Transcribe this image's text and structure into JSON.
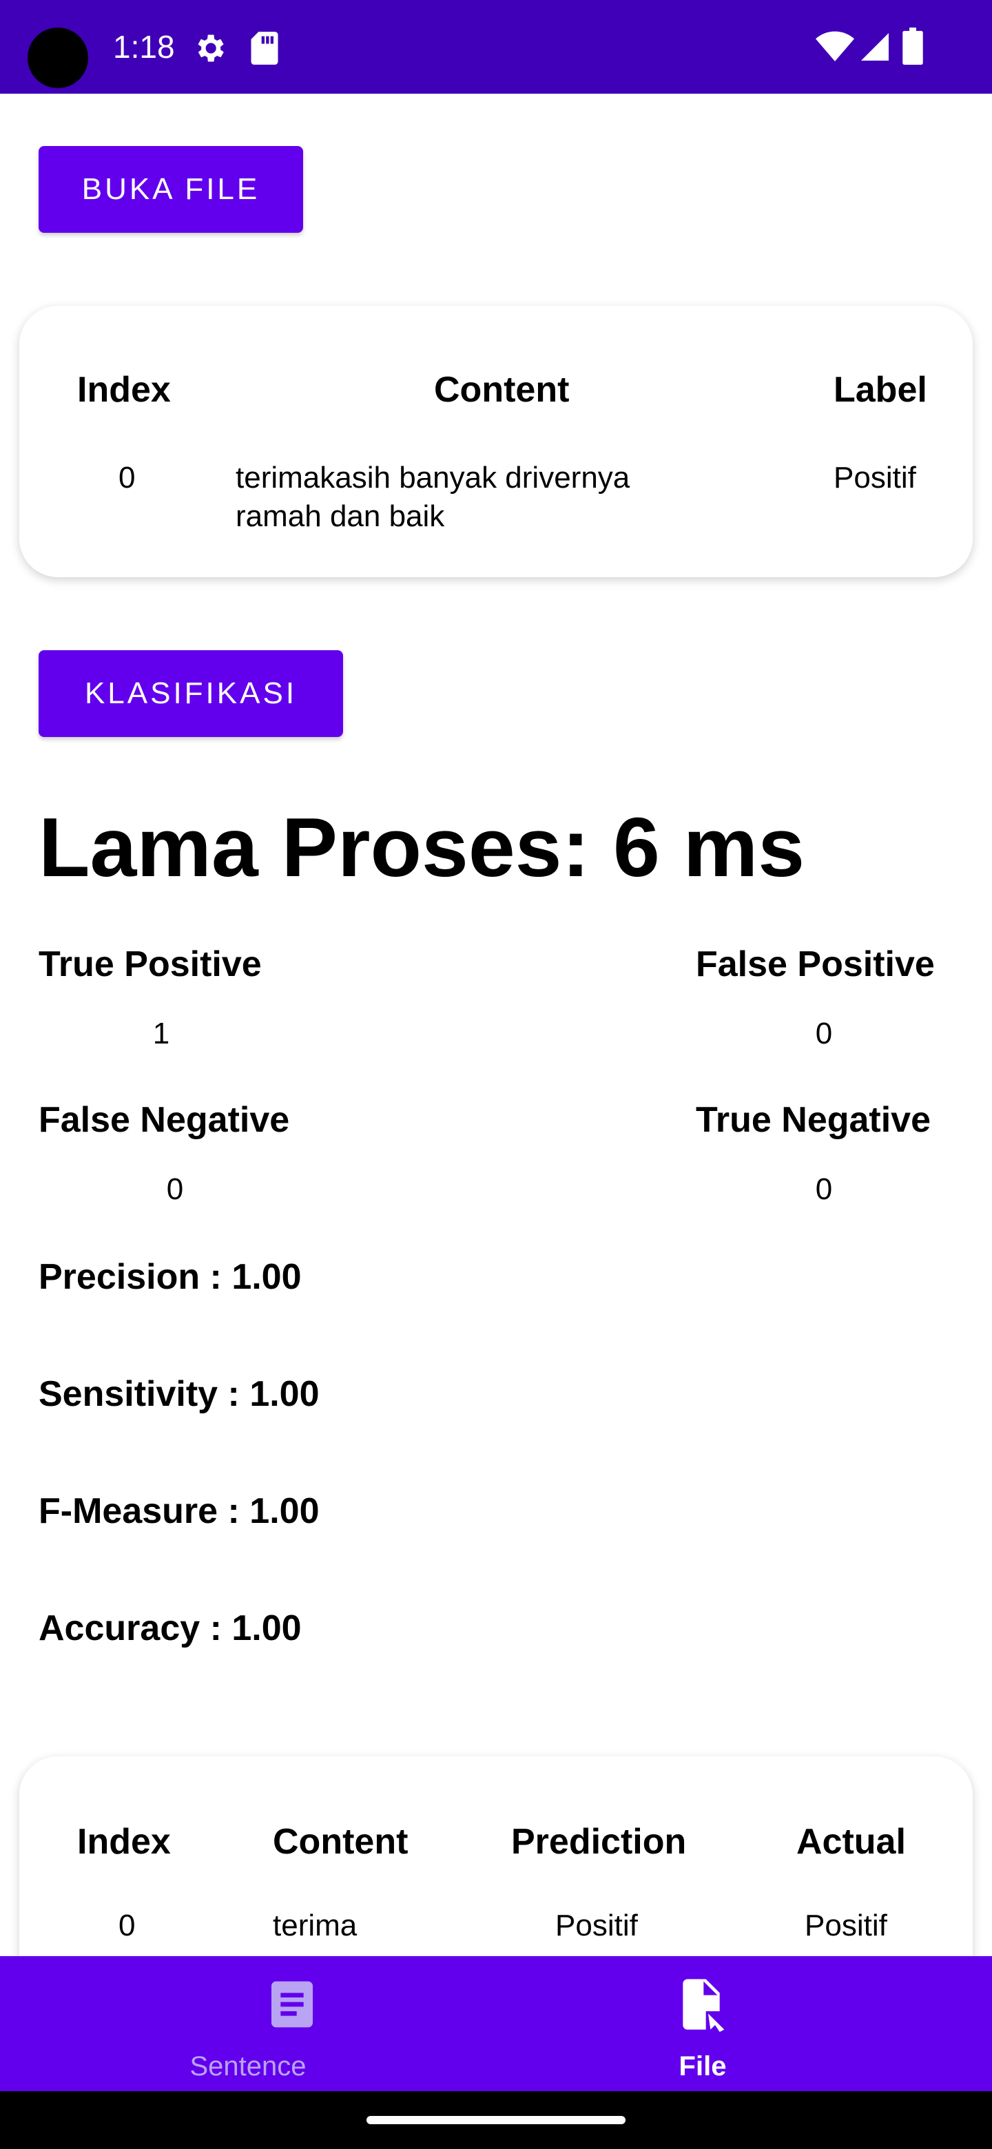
{
  "status_bar": {
    "time": "1:18",
    "icons": [
      "settings-gear-icon",
      "sd-card-icon",
      "wifi-icon",
      "cellular-signal-icon",
      "battery-icon"
    ]
  },
  "buka_file_button": "BUKA FILE",
  "input_table": {
    "headers": [
      "Index",
      "Content",
      "Label"
    ],
    "rows": [
      {
        "index": "0",
        "content_line1": "terimakasih banyak drivernya",
        "content_line2": "ramah dan baik",
        "label": "Positif"
      }
    ]
  },
  "klasifikasi_button": "KLASIFIKASI",
  "processing_time": "Lama Proses: 6 ms",
  "confusion_matrix": {
    "true_positive_label": "True Positive",
    "true_positive_value": "1",
    "false_positive_label": "False Positive",
    "false_positive_value": "0",
    "false_negative_label": "False Negative",
    "false_negative_value": "0",
    "true_negative_label": "True Negative",
    "true_negative_value": "0"
  },
  "scores": {
    "precision": "Precision : 1.00",
    "sensitivity": "Sensitivity : 1.00",
    "f_measure": "F-Measure : 1.00",
    "accuracy": "Accuracy : 1.00"
  },
  "result_table": {
    "headers": [
      "Index",
      "Content",
      "Prediction",
      "Actual"
    ],
    "rows": [
      {
        "index": "0",
        "content": "terima",
        "prediction": "Positif",
        "actual": "Positif"
      }
    ]
  },
  "bottom_nav": {
    "items": [
      {
        "label": "Sentence",
        "icon": "document-lines-icon",
        "selected": false
      },
      {
        "label": "File",
        "icon": "file-cursor-icon",
        "selected": true
      }
    ]
  },
  "colors": {
    "status_bar": "#4000B8",
    "primary": "#6200EE",
    "nav_inactive": "#B9A4F4",
    "on_primary": "#FFFFFF"
  }
}
